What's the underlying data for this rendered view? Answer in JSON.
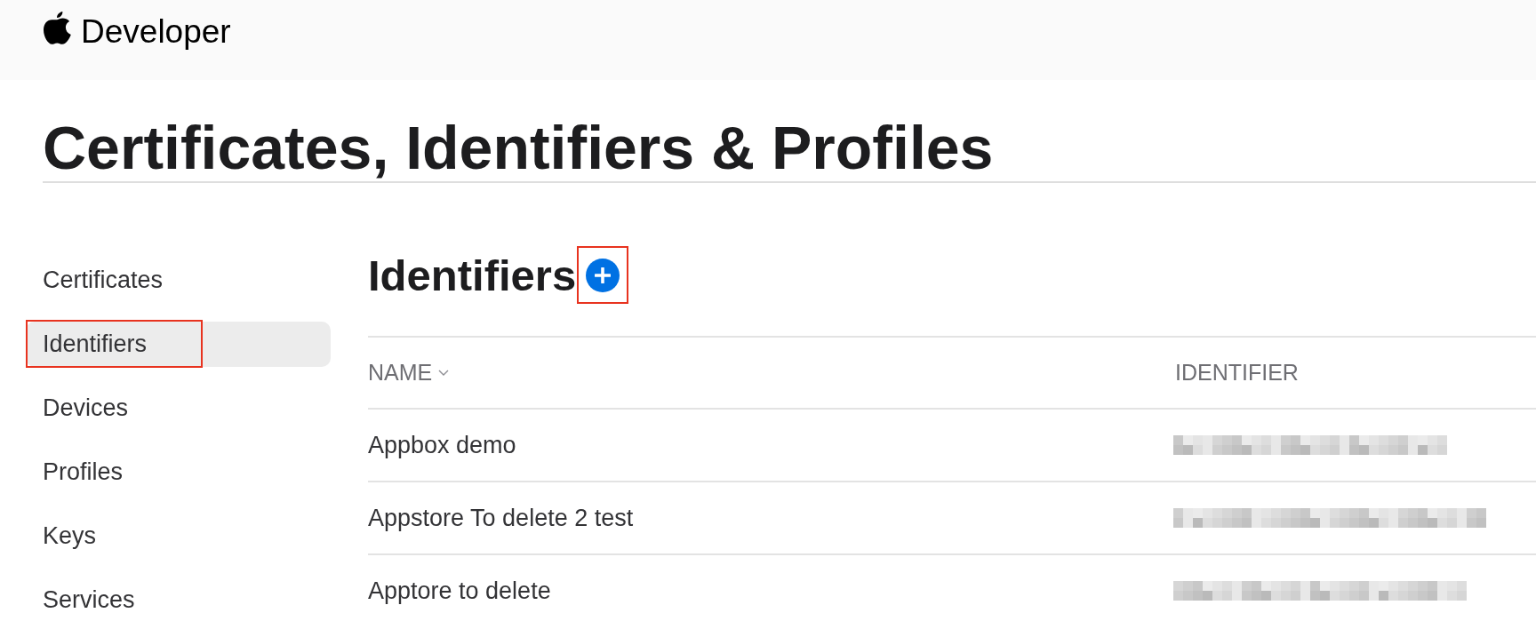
{
  "header": {
    "brand": "Developer"
  },
  "page_title": "Certificates, Identifiers & Profiles",
  "sidebar": {
    "items": [
      {
        "label": "Certificates",
        "selected": false,
        "highlighted": false
      },
      {
        "label": "Identifiers",
        "selected": true,
        "highlighted": true
      },
      {
        "label": "Devices",
        "selected": false,
        "highlighted": false
      },
      {
        "label": "Profiles",
        "selected": false,
        "highlighted": false
      },
      {
        "label": "Keys",
        "selected": false,
        "highlighted": false
      },
      {
        "label": "Services",
        "selected": false,
        "highlighted": false
      }
    ]
  },
  "section": {
    "title": "Identifiers",
    "add_button": {
      "highlighted": true
    }
  },
  "table": {
    "columns": [
      {
        "label": "NAME",
        "sorted": true
      },
      {
        "label": "IDENTIFIER",
        "sorted": false
      }
    ],
    "rows": [
      {
        "name": "Appbox demo",
        "identifier_redacted": true
      },
      {
        "name": "Appstore To delete 2 test",
        "identifier_redacted": true
      },
      {
        "name": "Apptore to delete",
        "identifier_redacted": true
      }
    ]
  }
}
